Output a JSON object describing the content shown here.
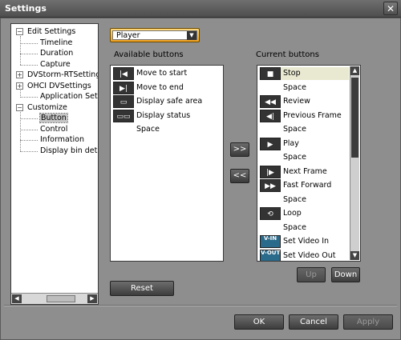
{
  "window": {
    "title": "Settings",
    "close_glyph": "✕"
  },
  "tree": {
    "items": [
      {
        "label": "Edit Settings",
        "toggle": "−"
      },
      {
        "label": "Timeline"
      },
      {
        "label": "Duration"
      },
      {
        "label": "Capture"
      },
      {
        "label": "DVStorm-RTSettings*",
        "toggle": "+"
      },
      {
        "label": "OHCI DVSettings",
        "toggle": "+"
      },
      {
        "label": "Application Settings"
      },
      {
        "label": "Customize",
        "toggle": "−"
      },
      {
        "label": "Button",
        "selected": true
      },
      {
        "label": "Control"
      },
      {
        "label": "Information"
      },
      {
        "label": "Display bin details"
      }
    ],
    "scroll_left": "◀",
    "scroll_right": "▶"
  },
  "dropdown": {
    "value": "Player",
    "arrow": "▼"
  },
  "available": {
    "label": "Available buttons",
    "items": [
      {
        "label": "Move to start",
        "icon": "|◀",
        "icon_name": "move-to-start-icon"
      },
      {
        "label": "Move to end",
        "icon": "▶|",
        "icon_name": "move-to-end-icon"
      },
      {
        "label": "Display safe area",
        "icon": "▭",
        "icon_name": "safe-area-icon"
      },
      {
        "label": "Display status",
        "icon": "▭▭",
        "icon_name": "display-status-icon"
      },
      {
        "label": "Space",
        "icon": "",
        "icon_name": "blank-icon"
      }
    ]
  },
  "transfer": {
    "add": ">>",
    "remove": "<<"
  },
  "current": {
    "label": "Current buttons",
    "items": [
      {
        "label": "Stop",
        "icon": "■",
        "icon_name": "stop-icon",
        "selected": true
      },
      {
        "label": "Space",
        "icon": "",
        "icon_name": "blank-icon"
      },
      {
        "label": "Review",
        "icon": "◀◀",
        "icon_name": "review-icon"
      },
      {
        "label": "Previous Frame",
        "icon": "◀|",
        "icon_name": "previous-frame-icon"
      },
      {
        "label": "Space",
        "icon": "",
        "icon_name": "blank-icon"
      },
      {
        "label": "Play",
        "icon": "▶",
        "icon_name": "play-icon"
      },
      {
        "label": "Space",
        "icon": "",
        "icon_name": "blank-icon"
      },
      {
        "label": "Next Frame",
        "icon": "|▶",
        "icon_name": "next-frame-icon"
      },
      {
        "label": "Fast Forward",
        "icon": "▶▶",
        "icon_name": "fast-forward-icon"
      },
      {
        "label": "Space",
        "icon": "",
        "icon_name": "blank-icon"
      },
      {
        "label": "Loop",
        "icon": "⟲",
        "icon_name": "loop-icon"
      },
      {
        "label": "Space",
        "icon": "",
        "icon_name": "blank-icon"
      },
      {
        "label": "Set Video In",
        "icon": "V-IN",
        "icon_name": "set-video-in-icon",
        "blue": true
      },
      {
        "label": "Set Video Out",
        "icon": "V-OUT",
        "icon_name": "set-video-out-icon",
        "blue": true
      }
    ],
    "scroll_up": "▲",
    "scroll_down": "▼"
  },
  "buttons": {
    "up": "Up",
    "down": "Down",
    "reset": "Reset",
    "ok": "OK",
    "cancel": "Cancel",
    "apply": "Apply"
  }
}
